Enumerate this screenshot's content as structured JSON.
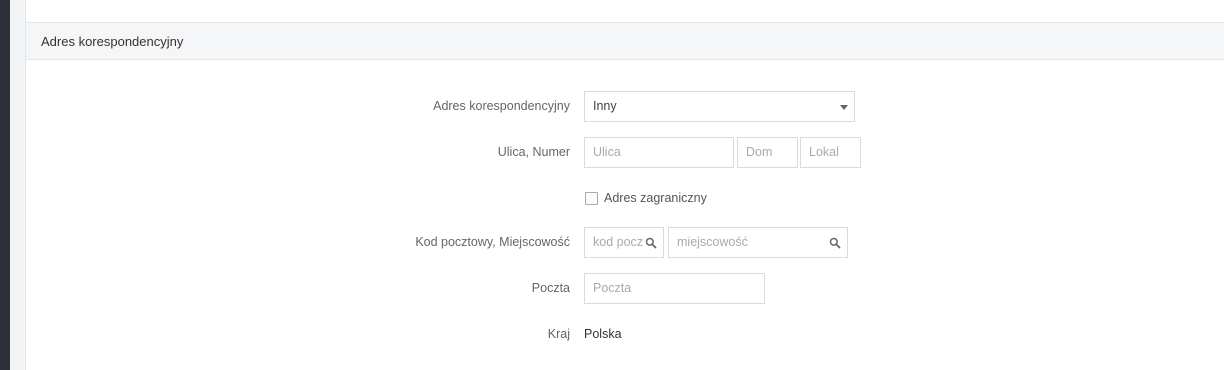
{
  "section": {
    "title": "Adres korespondencyjny"
  },
  "form": {
    "address_type": {
      "label": "Adres korespondencyjny",
      "value": "Inny"
    },
    "street": {
      "label": "Ulica, Numer",
      "street_placeholder": "Ulica",
      "house_placeholder": "Dom",
      "apartment_placeholder": "Lokal"
    },
    "foreign": {
      "label": "Adres zagraniczny",
      "checked": false
    },
    "postal": {
      "label": "Kod pocztowy, Miejscowość",
      "code_placeholder": "kod pocz",
      "city_placeholder": "miejscowość"
    },
    "post_office": {
      "label": "Poczta",
      "placeholder": "Poczta"
    },
    "country": {
      "label": "Kraj",
      "value": "Polska"
    }
  },
  "icons": {
    "select_caret": "chevron-down-icon",
    "search": "search-icon"
  },
  "colors": {
    "sidebar": "#2d3038",
    "header_bg": "#f5f6f7",
    "border": "#d8dbe0"
  }
}
